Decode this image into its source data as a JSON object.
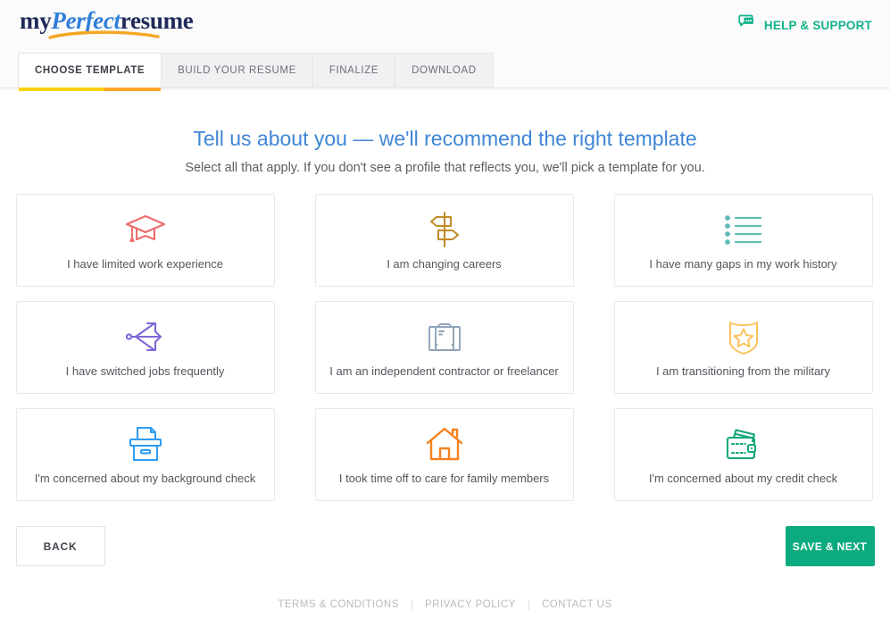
{
  "header": {
    "logo": {
      "part1": "my",
      "part2": "Perfect",
      "part3": "resume",
      "swoosh_color": "#f5a623"
    },
    "help": {
      "label": "HELP & SUPPORT",
      "icon": "chat-bubbles-icon",
      "color": "#13b28a"
    }
  },
  "tabs": [
    {
      "label": "CHOOSE TEMPLATE",
      "active": true
    },
    {
      "label": "BUILD YOUR RESUME",
      "active": false
    },
    {
      "label": "FINALIZE",
      "active": false
    },
    {
      "label": "DOWNLOAD",
      "active": false
    }
  ],
  "tab_underline": {
    "left_color": "#ffd100",
    "right_color": "#ffa62b"
  },
  "main": {
    "title": "Tell us about you — we'll recommend the right template",
    "subtitle": "Select all that apply. If you don't see a profile that reflects you, we'll pick a template for you.",
    "title_color": "#3f86d4"
  },
  "cards": [
    {
      "label": "I have limited work experience",
      "icon": "graduation-cap-icon",
      "color": "#ef6c6c"
    },
    {
      "label": "I am changing careers",
      "icon": "signpost-icon",
      "color": "#c08a27"
    },
    {
      "label": "I have many gaps in my work history",
      "icon": "bullet-list-icon",
      "color": "#5fbcb5"
    },
    {
      "label": "I have switched jobs frequently",
      "icon": "branching-arrows-icon",
      "color": "#8067d8"
    },
    {
      "label": "I am an independent contractor or freelancer",
      "icon": "briefcase-icon",
      "color": "#8fa3b8"
    },
    {
      "label": "I am transitioning from the military",
      "icon": "shield-star-icon",
      "color": "#fcc25c"
    },
    {
      "label": "I'm concerned about my background check",
      "icon": "file-box-icon",
      "color": "#2f9cf4"
    },
    {
      "label": "I took time off to care for family members",
      "icon": "house-icon",
      "color": "#f5821f"
    },
    {
      "label": "I'm concerned about my credit check",
      "icon": "wallet-icon",
      "color": "#12a87a"
    }
  ],
  "actions": {
    "back_label": "BACK",
    "save_label": "SAVE & NEXT",
    "save_color": "#0cab7f"
  },
  "footer": {
    "links": [
      "TERMS & CONDITIONS",
      "PRIVACY POLICY",
      "CONTACT US"
    ],
    "separator": "|"
  }
}
